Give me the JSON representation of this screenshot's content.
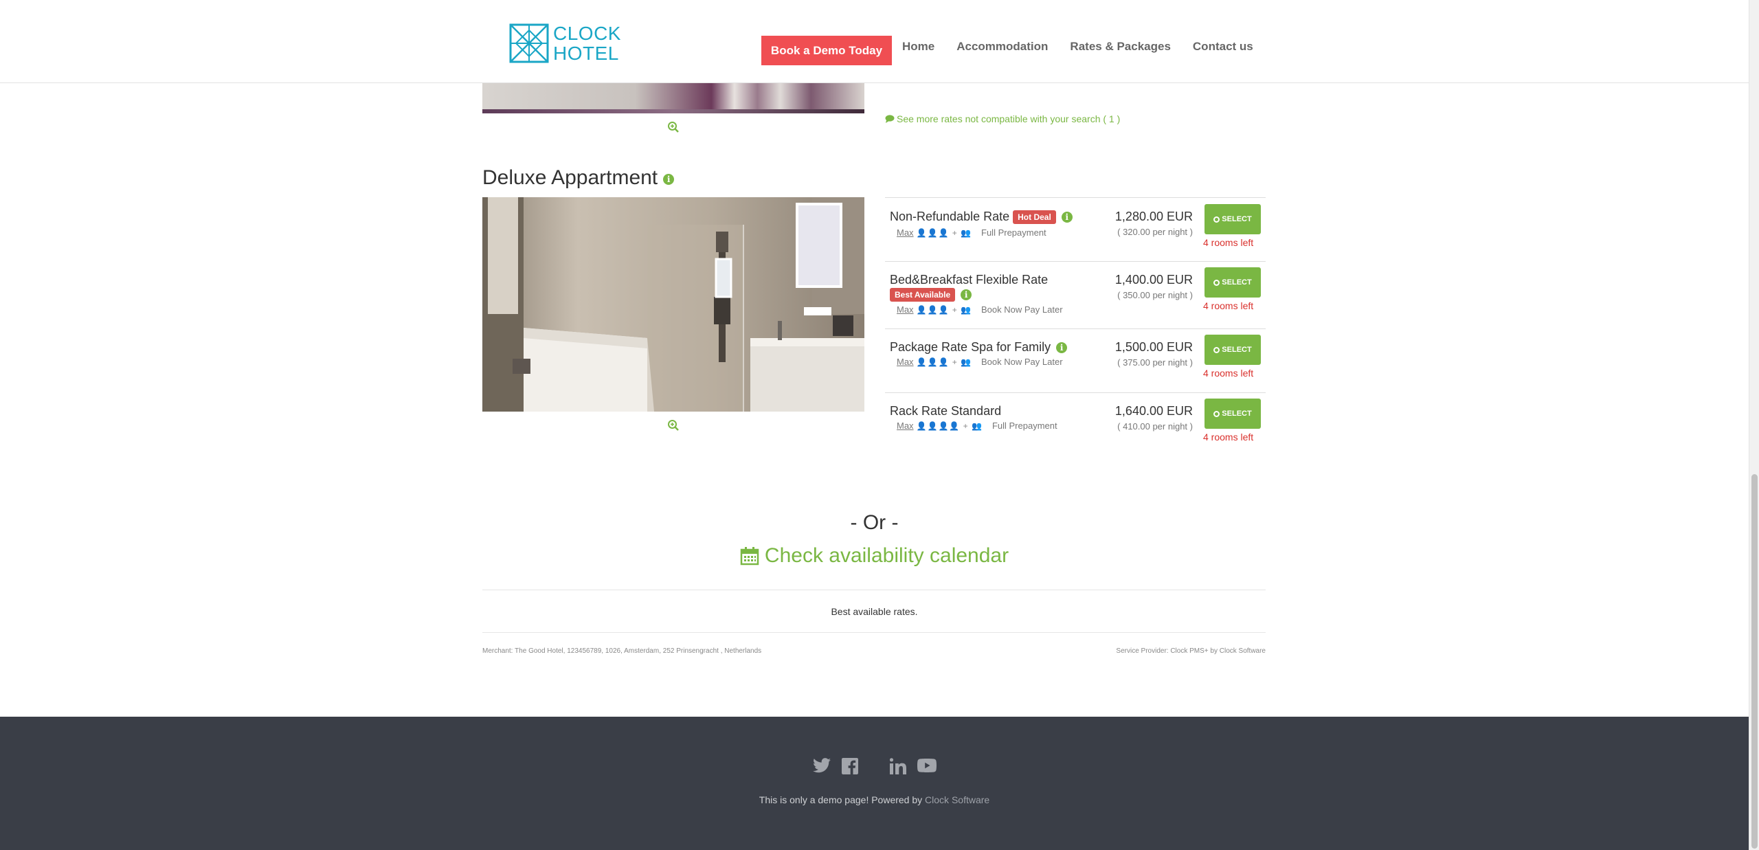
{
  "header": {
    "logo_line1": "CLOCK",
    "logo_line2": "HOTEL",
    "demo_button": "Book a Demo Today",
    "nav": [
      "Home",
      "Accommodation",
      "Rates & Packages",
      "Contact us"
    ]
  },
  "previous_room": {
    "more_rates_text": "See more rates not compatible with your search ( 1 )"
  },
  "room": {
    "title": "Deluxe Appartment",
    "rates": [
      {
        "name": "Non-Refundable Rate",
        "badge": "Hot Deal",
        "max_label": "Max",
        "payment": "Full Prepayment",
        "total": "1,280.00 EUR",
        "per_night": "( 320.00 per night )",
        "select_label": "SELECT",
        "rooms_left": "4 rooms left"
      },
      {
        "name": "Bed&Breakfast Flexible Rate",
        "badge": "Best Available",
        "max_label": "Max",
        "payment": "Book Now Pay Later",
        "total": "1,400.00 EUR",
        "per_night": "( 350.00 per night )",
        "select_label": "SELECT",
        "rooms_left": "4 rooms left"
      },
      {
        "name": "Package Rate Spa for Family",
        "badge": "",
        "max_label": "Max",
        "payment": "Book Now Pay Later",
        "total": "1,500.00 EUR",
        "per_night": "( 375.00 per night )",
        "select_label": "SELECT",
        "rooms_left": "4 rooms left"
      },
      {
        "name": "Rack Rate Standard",
        "badge": "",
        "max_label": "Max",
        "payment": "Full Prepayment",
        "total": "1,640.00 EUR",
        "per_night": "( 410.00 per night )",
        "select_label": "SELECT",
        "rooms_left": "4 rooms left"
      }
    ]
  },
  "or_text": "- Or -",
  "calendar_link": "Check availability calendar",
  "best_rates": "Best available rates.",
  "merchant": "Merchant: The Good Hotel, 123456789, 1026, Amsterdam, 252 Prinsengracht , Netherlands",
  "provider": "Service Provider: Clock PMS+ by Clock Software",
  "footer": {
    "text": "This is only a demo page! Powered by",
    "link": "Clock Software",
    "icons": [
      "twitter-icon",
      "facebook-icon",
      "linkedin-icon",
      "youtube-icon"
    ]
  },
  "colors": {
    "accent_green": "#7ab743",
    "red": "#f04e52",
    "badge_red": "#d9534f",
    "logo_blue": "#1aa6c6",
    "footer_bg": "#3a3e47"
  }
}
